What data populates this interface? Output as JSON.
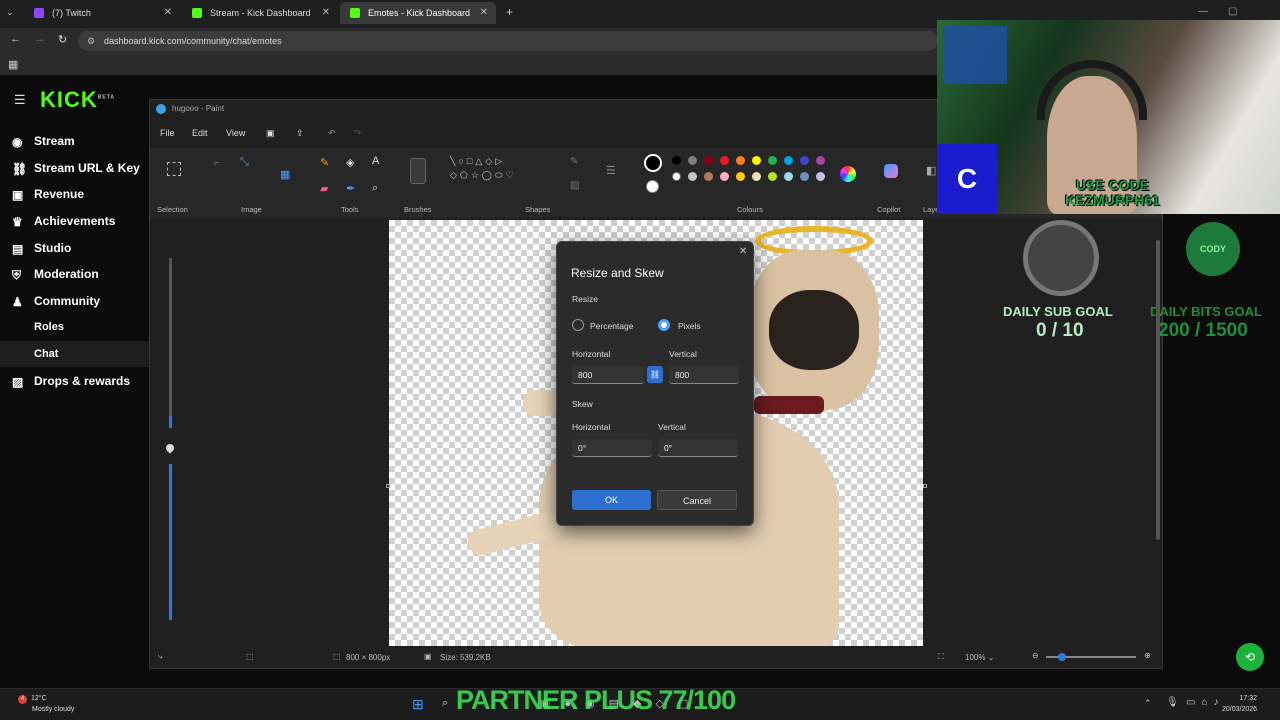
{
  "browser": {
    "tabs": [
      {
        "label": "(7) Twitch",
        "color": "#9146ff"
      },
      {
        "label": "Stream - Kick Dashboard",
        "color": "#53fc18"
      },
      {
        "label": "Emotes - Kick Dashboard",
        "color": "#53fc18"
      }
    ],
    "url": "dashboard.kick.com/community/chat/emotes"
  },
  "kick": {
    "logo": "KICK",
    "logo_badge": "BETA",
    "nav": [
      {
        "label": "Stream",
        "icon": "broadcast-icon"
      },
      {
        "label": "Stream URL & Key",
        "icon": "link-icon"
      },
      {
        "label": "Revenue",
        "icon": "revenue-icon"
      },
      {
        "label": "Achievements",
        "icon": "trophy-icon"
      },
      {
        "label": "Studio",
        "icon": "studio-icon"
      },
      {
        "label": "Moderation",
        "icon": "shield-icon"
      },
      {
        "label": "Community",
        "icon": "community-icon"
      }
    ],
    "sub": [
      {
        "label": "Roles"
      },
      {
        "label": "Chat",
        "active": true
      }
    ],
    "drops": "Drops & rewards"
  },
  "paint": {
    "title": "hugooo - Paint",
    "menu": [
      "File",
      "Edit",
      "View"
    ],
    "groups": [
      "Selection",
      "Image",
      "Tools",
      "Brushes",
      "Shapes",
      "Colours",
      "Copilot",
      "Layers"
    ],
    "palette_row1": [
      "#000000",
      "#7f7f7f",
      "#880015",
      "#ed1c24",
      "#ff7f27",
      "#fff200",
      "#22b14c",
      "#00a2e8",
      "#3f48cc",
      "#a349a4"
    ],
    "palette_row2": [
      "#ffffff",
      "#c3c3c3",
      "#b97a57",
      "#ffaec9",
      "#ffc90e",
      "#efe4b0",
      "#b5e61d",
      "#99d9ea",
      "#7092be",
      "#c8bfe7"
    ],
    "status": {
      "dimensions": "800 × 800px",
      "size": "Size: 539.2KB",
      "zoom": "100%"
    }
  },
  "dialog": {
    "title": "Resize and Skew",
    "resize_label": "Resize",
    "percentage": "Percentage",
    "pixels": "Pixels",
    "h_label": "Horizontal",
    "v_label": "Vertical",
    "h_value": "800",
    "v_value": "800",
    "skew_label": "Skew",
    "skew_h_label": "Horizontal",
    "skew_v_label": "Vertical",
    "skew_h": "0°",
    "skew_v": "0°",
    "ok": "OK",
    "cancel": "Cancel"
  },
  "overlay": {
    "code_line1": "USE CODE",
    "code_line2": "KEZMURPH61",
    "sub_goal_label": "DAILY SUB GOAL",
    "sub_goal_value": "0 / 10",
    "bits_goal_label": "DAILY BITS GOAL",
    "bits_goal_value": "200 / 1500",
    "partner": "PARTNER PLUS 77/100",
    "badge_letter": "C",
    "badge_text": "CODY"
  },
  "taskbar": {
    "weather_temp": "12°C",
    "weather_desc": "Mostly cloudy",
    "time": "17:32",
    "date": "20/03/2026",
    "notif_count": "4"
  }
}
